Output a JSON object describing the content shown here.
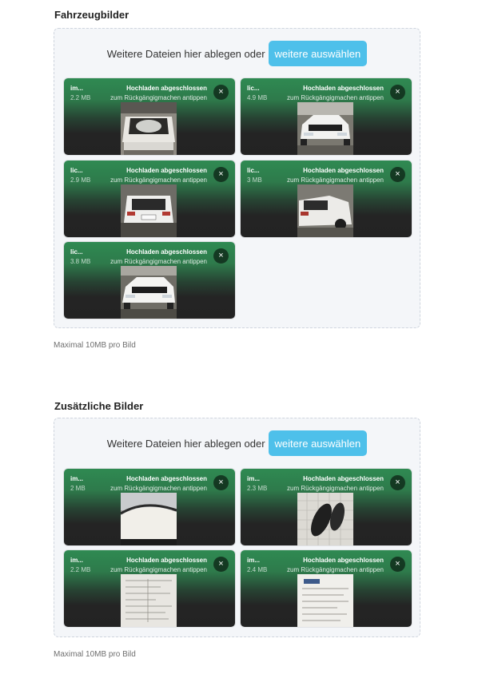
{
  "sections": [
    {
      "title": "Fahrzeugbilder",
      "drop_text": "Weitere Dateien hier ablegen oder",
      "browse_label": "weitere auswählen",
      "hint": "Maximal 10MB pro Bild",
      "files": [
        {
          "name": "im...",
          "size": "2.2 MB",
          "status": "Hochladen abgeschlossen",
          "undo": "zum Rückgängigmachen antippen",
          "remove": "×",
          "thumb": "car-trunk"
        },
        {
          "name": "lic...",
          "size": "4.9 MB",
          "status": "Hochladen abgeschlossen",
          "undo": "zum Rückgängigmachen antippen",
          "remove": "×",
          "thumb": "car-front"
        },
        {
          "name": "lic...",
          "size": "2.9 MB",
          "status": "Hochladen abgeschlossen",
          "undo": "zum Rückgängigmachen antippen",
          "remove": "×",
          "thumb": "car-rear"
        },
        {
          "name": "lic...",
          "size": "3 MB",
          "status": "Hochladen abgeschlossen",
          "undo": "zum Rückgängigmachen antippen",
          "remove": "×",
          "thumb": "car-rear-side"
        },
        {
          "name": "lic...",
          "size": "3.8 MB",
          "status": "Hochladen abgeschlossen",
          "undo": "zum Rückgängigmachen antippen",
          "remove": "×",
          "thumb": "car-front"
        }
      ]
    },
    {
      "title": "Zusätzliche Bilder",
      "drop_text": "Weitere Dateien hier ablegen oder",
      "browse_label": "weitere auswählen",
      "hint": "Maximal 10MB pro Bild",
      "files": [
        {
          "name": "im...",
          "size": "2 MB",
          "status": "Hochladen abgeschlossen",
          "undo": "zum Rückgängigmachen antippen",
          "remove": "×",
          "thumb": "car-roof"
        },
        {
          "name": "im...",
          "size": "2.3 MB",
          "status": "Hochladen abgeschlossen",
          "undo": "zum Rückgängigmachen antippen",
          "remove": "×",
          "thumb": "car-keys"
        },
        {
          "name": "im...",
          "size": "2.2 MB",
          "status": "Hochladen abgeschlossen",
          "undo": "zum Rückgängigmachen antippen",
          "remove": "×",
          "thumb": "document"
        },
        {
          "name": "im...",
          "size": "2.4 MB",
          "status": "Hochladen abgeschlossen",
          "undo": "zum Rückgängigmachen antippen",
          "remove": "×",
          "thumb": "document"
        }
      ]
    }
  ],
  "colors": {
    "accent": "#4ec0ea",
    "tile_green": "#2f8a52",
    "tile_dark": "#232323",
    "dropzone_bg": "#f4f6f9"
  }
}
